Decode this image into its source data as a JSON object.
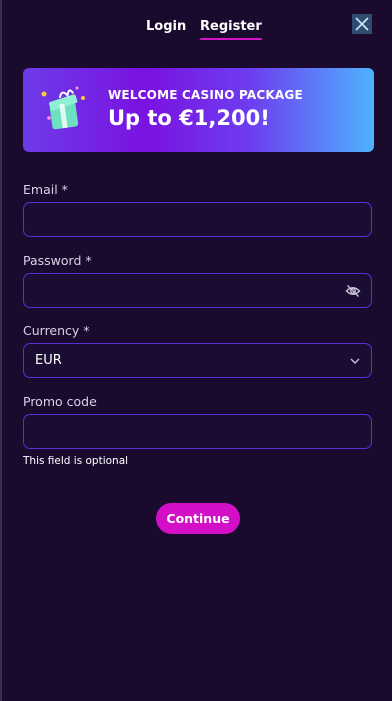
{
  "tabs": {
    "login": "Login",
    "register": "Register",
    "active": "register"
  },
  "close": {
    "icon": "close-icon"
  },
  "banner": {
    "title": "WELCOME CASINO PACKAGE",
    "amount": "Up to €1,200!",
    "icon": "gift-icon"
  },
  "form": {
    "email": {
      "label": "Email *",
      "value": "",
      "placeholder": ""
    },
    "password": {
      "label": "Password *",
      "value": "",
      "placeholder": "",
      "icon": "eye-off-icon"
    },
    "currency": {
      "label": "Currency *",
      "value": "EUR",
      "icon": "chevron-down-icon"
    },
    "promo": {
      "label": "Promo code",
      "value": "",
      "placeholder": "",
      "hint": "This field is optional"
    }
  },
  "continue_label": "Continue",
  "colors": {
    "background": "#1a0b2e",
    "accent": "#d30fc7",
    "field_border": "#5a2fd4",
    "close_bg": "#2d4e72"
  }
}
